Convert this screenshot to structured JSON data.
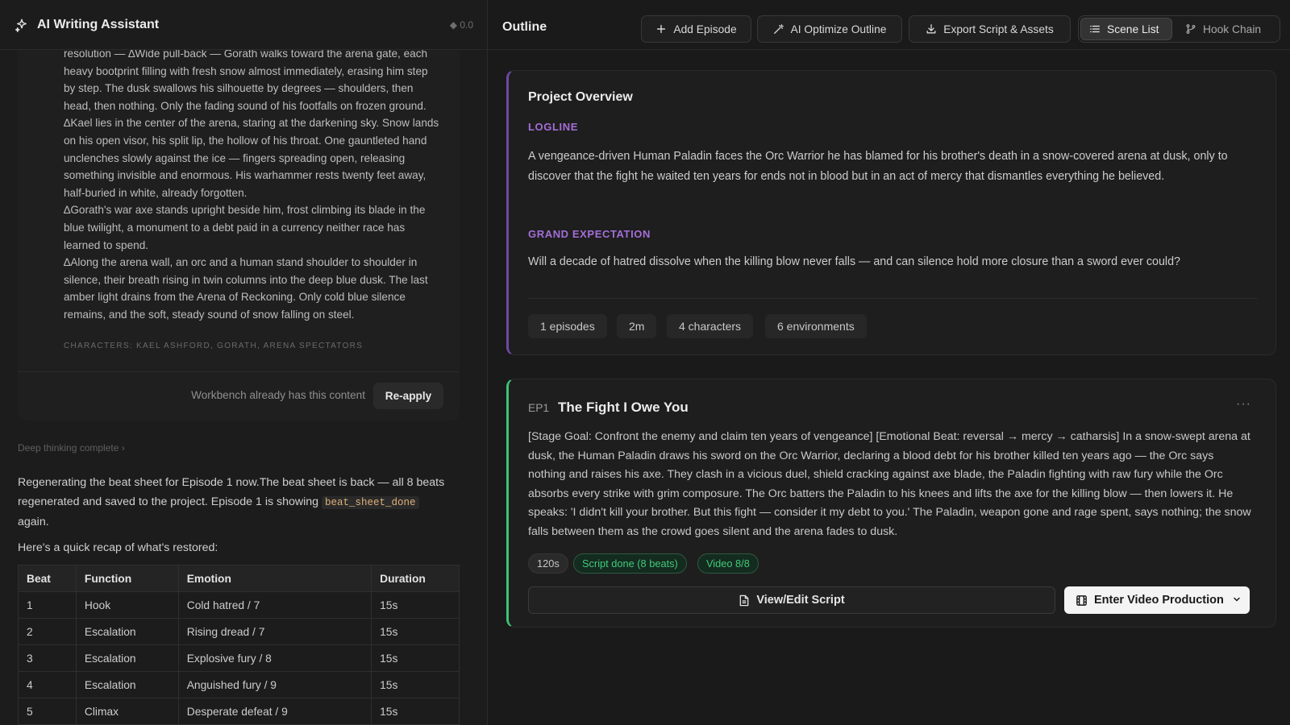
{
  "left_panel": {
    "title": "AI Writing Assistant",
    "version": "0.0",
    "script_paragraphs": [
      "resolution — ∆Wide pull-back — Gorath walks toward the arena gate, each heavy bootprint filling with fresh snow almost immediately, erasing him step by step. The dusk swallows his silhouette by degrees — shoulders, then head, then nothing. Only the fading sound of his footfalls on frozen ground.",
      "∆Kael lies in the center of the arena, staring at the darkening sky. Snow lands on his open visor, his split lip, the hollow of his throat. One gauntleted hand unclenches slowly against the ice — fingers spreading open, releasing something invisible and enormous. His warhammer rests twenty feet away, half-buried in white, already forgotten.",
      "∆Gorath's war axe stands upright beside him, frost climbing its blade in the blue twilight, a monument to a debt paid in a currency neither race has learned to spend.",
      "∆Along the arena wall, an orc and a human stand shoulder to shoulder in silence, their breath rising in twin columns into the deep blue dusk. The last amber light drains from the Arena of Reckoning. Only cold blue silence remains, and the soft, steady sound of snow falling on steel."
    ],
    "characters": "CHARACTERS: KAEL ASHFORD, GORATH, ARENA SPECTATORS",
    "workbench_note": "Workbench already has this content",
    "reapply_label": "Re-apply",
    "deep_thinking": "Deep thinking complete",
    "message_part1": "Regenerating the beat sheet for Episode 1 now.The beat sheet is back — all 8 beats regenerated and saved to the project. Episode 1 is showing ",
    "message_code": "beat_sheet_done",
    "message_part2": " again.",
    "recap": "Here's a quick recap of what's restored:",
    "table": {
      "headers": [
        "Beat",
        "Function",
        "Emotion",
        "Duration"
      ],
      "rows": [
        [
          "1",
          "Hook",
          "Cold hatred / 7",
          "15s"
        ],
        [
          "2",
          "Escalation",
          "Rising dread / 7",
          "15s"
        ],
        [
          "3",
          "Escalation",
          "Explosive fury / 8",
          "15s"
        ],
        [
          "4",
          "Escalation",
          "Anguished fury / 9",
          "15s"
        ],
        [
          "5",
          "Climax",
          "Desperate defeat / 9",
          "15s"
        ]
      ]
    }
  },
  "right_panel": {
    "title": "Outline",
    "toolbar": {
      "add_episode": "Add Episode",
      "ai_optimize": "AI Optimize Outline",
      "export": "Export Script & Assets",
      "scene_list": "Scene List",
      "hook_chain": "Hook Chain"
    },
    "overview": {
      "title": "Project Overview",
      "logline_label": "LOGLINE",
      "logline": "A vengeance-driven Human Paladin faces the Orc Warrior he has blamed for his brother's death in a snow-covered arena at dusk, only to discover that the fight he waited ten years for ends not in blood but in an act of mercy that dismantles everything he believed.",
      "expectation_label": "GRAND EXPECTATION",
      "expectation": "Will a decade of hatred dissolve when the killing blow never falls — and can silence hold more closure than a sword ever could?",
      "stats": [
        "1 episodes",
        "2m",
        "4 characters",
        "6 environments"
      ]
    },
    "episode": {
      "code": "EP1",
      "title": "The Fight I Owe You",
      "more": "···",
      "description": "[Stage Goal: Confront the enemy and claim ten years of vengeance] [Emotional Beat: reversal → mercy → catharsis] In a snow-swept arena at dusk, the Human Paladin draws his sword on the Orc Warrior, declaring a blood debt for his brother killed ten years ago — the Orc says nothing and raises his axe. They clash in a vicious duel, shield cracking against axe blade, the Paladin fighting with raw fury while the Orc absorbs every strike with grim composure. The Orc batters the Paladin to his knees and lifts the axe for the killing blow — then lowers it. He speaks: 'I didn't kill your brother. But this fight — consider it my debt to you.' The Paladin, weapon gone and rage spent, says nothing; the snow falls between them as the crowd goes silent and the arena fades to dusk.",
      "tags": [
        "120s",
        "Script done (8 beats)",
        "Video 8/8"
      ],
      "view_edit": "View/Edit Script",
      "enter_video": "Enter Video Production"
    }
  },
  "colors": {
    "accent_purple": "#a46ed8",
    "accent_green": "#3ec276",
    "background": "#1a1a1a"
  }
}
